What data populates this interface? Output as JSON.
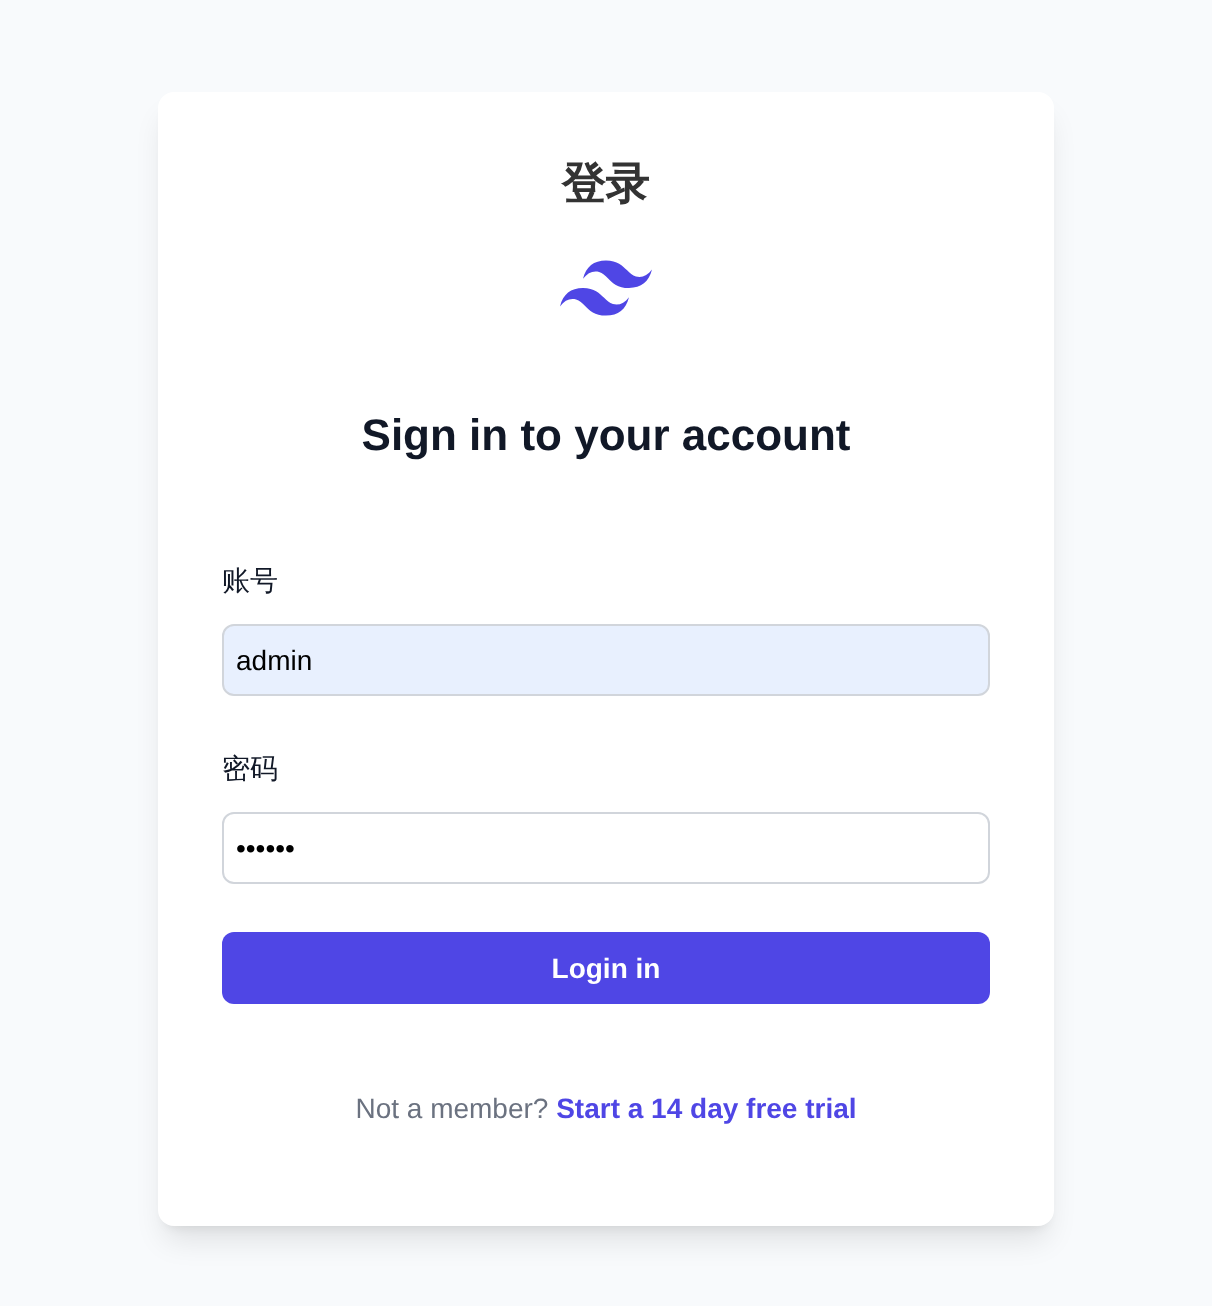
{
  "card": {
    "title": "登录",
    "heading": "Sign in to your account"
  },
  "fields": [
    {
      "label": "账号",
      "value": "admin",
      "autofilled": true
    },
    {
      "label": "密码",
      "value": "••••••",
      "autofilled": false
    }
  ],
  "submit": "Login in",
  "footer": {
    "text": "Not a member?",
    "link": "Start a 14 day free trial"
  }
}
